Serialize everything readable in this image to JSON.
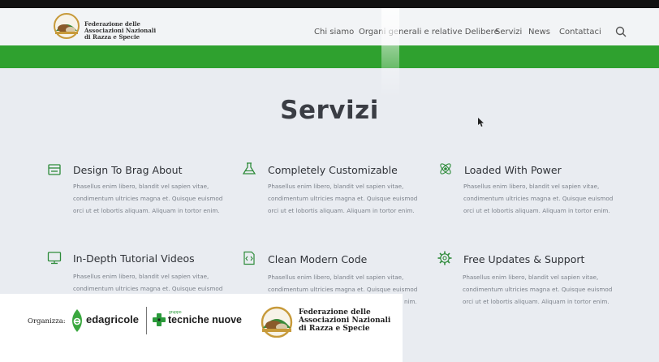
{
  "brand": {
    "name_lines": [
      "Federazione delle",
      "Associazioni Nazionali",
      "di Razza e Specie"
    ]
  },
  "nav": {
    "items": [
      "Chi siamo",
      "Organi generali e relative Delibere",
      "Servizi",
      "News",
      "Contattaci"
    ]
  },
  "page": {
    "title": "Servizi"
  },
  "features": [
    {
      "title": "Design To Brag About",
      "icon": "tray-icon",
      "desc_lines": [
        "Phasellus enim libero, blandit vel sapien vitae,",
        "condimentum ultricies magna et. Quisque euismod",
        "orci ut et lobortis aliquam. Aliquam in tortor enim."
      ]
    },
    {
      "title": "Completely Customizable",
      "icon": "flask-icon",
      "desc_lines": [
        "Phasellus enim libero, blandit vel sapien vitae,",
        "condimentum ultricies magna et. Quisque euismod",
        "orci ut et lobortis aliquam. Aliquam in tortor enim."
      ]
    },
    {
      "title": "Loaded With Power",
      "icon": "atom-icon",
      "desc_lines": [
        "Phasellus enim libero, blandit vel sapien vitae,",
        "condimentum ultricies magna et. Quisque euismod",
        "orci ut et lobortis aliquam. Aliquam in tortor enim."
      ]
    },
    {
      "title": "In-Depth Tutorial Videos",
      "icon": "monitor-icon",
      "desc_lines": [
        "Phasellus enim libero, blandit vel sapien vitae,",
        "condimentum ultricies magna et. Quisque euismod"
      ]
    },
    {
      "title": "Clean Modern Code",
      "icon": "code-file-icon",
      "desc_lines": [
        "Phasellus enim libero, blandit vel sapien vitae,",
        "condimentum ultricies magna et. Quisque euismod",
        "nim."
      ]
    },
    {
      "title": "Free Updates & Support",
      "icon": "gear-icon",
      "desc_lines": [
        "Phasellus enim libero, blandit vel sapien vitae,",
        "condimentum ultricies magna et. Quisque euismod",
        "orci ut et lobortis aliquam. Aliquam in tortor enim."
      ]
    }
  ],
  "sponsors": {
    "label": "Organizza:",
    "edagricole": "edagricole",
    "tn_small": "gruppo",
    "tn": "tecniche nuove",
    "fed_lines": [
      "Federazione delle",
      "Associazioni Nazionali",
      "di Razza e Specie"
    ]
  },
  "colors": {
    "brand_green": "#2fa12f",
    "icon_green": "#2e8b3a",
    "title_text": "#3a3d44",
    "desc_text": "#7b818a"
  }
}
